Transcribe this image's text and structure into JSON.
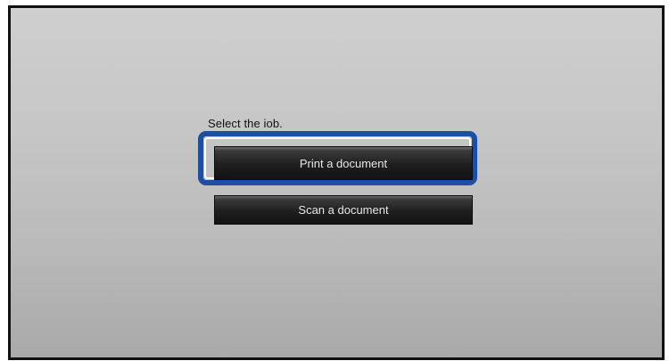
{
  "screen": {
    "prompt_text": "Select the iob."
  },
  "jobs": {
    "print_label": "Print a document",
    "scan_label": "Scan a document"
  },
  "colors": {
    "focus_ring": "#1c4ea3",
    "button_bg": "#1f1f1f",
    "button_text": "#e6e6e6",
    "screen_bg": "#c6c6c6"
  }
}
